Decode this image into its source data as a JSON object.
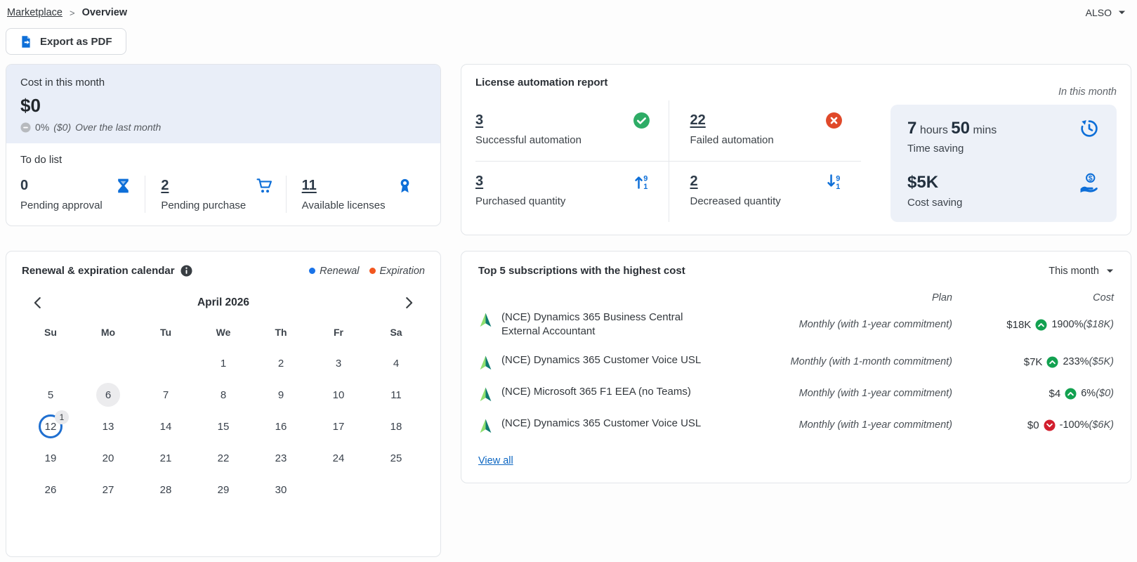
{
  "colors": {
    "accent_blue": "#0e6fd8",
    "success_green": "#2eac66",
    "fail_red": "#e0492a",
    "trend_up_green": "#12a150",
    "trend_down_red": "#d21f2e",
    "renewal_blue": "#1a73e8",
    "expiration_orange": "#f2571f"
  },
  "header": {
    "breadcrumb": {
      "parent": "Marketplace",
      "separator": ">",
      "current": "Overview"
    },
    "account": "ALSO",
    "export_label": "Export as PDF"
  },
  "cost_card": {
    "title": "Cost in this month",
    "amount": "$0",
    "change_percent": "0%",
    "change_amount": "($0)",
    "change_note": "Over the last month",
    "todo_title": "To do list",
    "todo_items": [
      {
        "value": "0",
        "label": "Pending approval",
        "icon": "hourglass-icon",
        "linked": false
      },
      {
        "value": "2",
        "label": "Pending purchase",
        "icon": "cart-icon",
        "linked": true
      },
      {
        "value": "11",
        "label": "Available licenses",
        "icon": "award-icon",
        "linked": true
      }
    ]
  },
  "automation_card": {
    "title": "License automation report",
    "period": "In this month",
    "stats": [
      {
        "value": "3",
        "label": "Successful automation",
        "icon": "check-circle-icon"
      },
      {
        "value": "22",
        "label": "Failed automation",
        "icon": "x-circle-icon"
      },
      {
        "value": "3",
        "label": "Purchased quantity",
        "icon": "sort-numeric-up-icon"
      },
      {
        "value": "2",
        "label": "Decreased quantity",
        "icon": "sort-numeric-down-icon"
      }
    ],
    "time_saving": {
      "hours": "7",
      "hours_unit": "hours",
      "mins": "50",
      "mins_unit": "mins",
      "label": "Time saving",
      "icon": "history-icon"
    },
    "cost_saving": {
      "value": "$5K",
      "label": "Cost saving",
      "icon": "hand-dollar-icon"
    }
  },
  "calendar_card": {
    "title": "Renewal & expiration calendar",
    "legend": [
      {
        "label": "Renewal",
        "color": "#1a73e8"
      },
      {
        "label": "Expiration",
        "color": "#f2571f"
      }
    ],
    "month": "April 2026",
    "day_headers": [
      "Su",
      "Mo",
      "Tu",
      "We",
      "Th",
      "Fr",
      "Sa"
    ],
    "weeks": [
      [
        "",
        "",
        "",
        "1",
        "2",
        "3",
        "4"
      ],
      [
        "5",
        "6",
        "7",
        "8",
        "9",
        "10",
        "11"
      ],
      [
        "12",
        "13",
        "14",
        "15",
        "16",
        "17",
        "18"
      ],
      [
        "19",
        "20",
        "21",
        "22",
        "23",
        "24",
        "25"
      ],
      [
        "26",
        "27",
        "28",
        "29",
        "30",
        "",
        ""
      ]
    ],
    "today_day": "6",
    "selected_day": "12",
    "selected_badge": "1"
  },
  "subscriptions_card": {
    "title": "Top 5 subscriptions with the highest cost",
    "filter": "This month",
    "col_plan": "Plan",
    "col_cost": "Cost",
    "rows": [
      {
        "name": "(NCE) Dynamics 365 Business Central External Accountant",
        "plan": "Monthly (with 1-year commitment)",
        "cost": "$18K",
        "trend": "up",
        "percent": "1900%",
        "previous": "($18K)"
      },
      {
        "name": "(NCE) Dynamics 365 Customer Voice USL",
        "plan": "Monthly (with 1-month commitment)",
        "cost": "$7K",
        "trend": "up",
        "percent": "233%",
        "previous": "($5K)"
      },
      {
        "name": "(NCE) Microsoft 365 F1 EEA (no Teams)",
        "plan": "Monthly (with 1-year commitment)",
        "cost": "$4",
        "trend": "up",
        "percent": "6%",
        "previous": "($0)"
      },
      {
        "name": "(NCE) Dynamics 365 Customer Voice USL",
        "plan": "Monthly (with 1-year commitment)",
        "cost": "$0",
        "trend": "down",
        "percent": "-100%",
        "previous": "($6K)"
      }
    ],
    "view_all": "View all"
  }
}
